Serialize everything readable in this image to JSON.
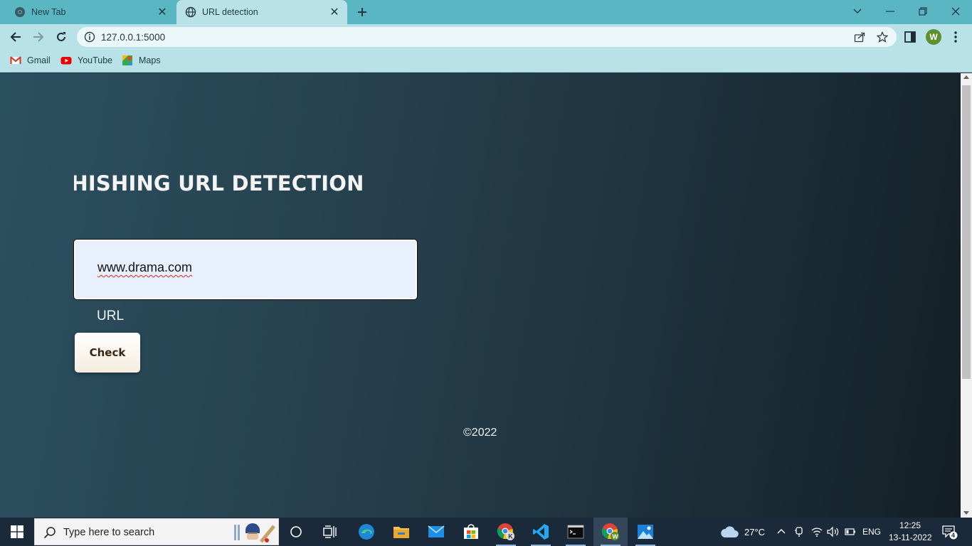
{
  "browser": {
    "tabs": [
      {
        "title": "New Tab",
        "active": false
      },
      {
        "title": "URL detection",
        "active": true
      }
    ],
    "address": "127.0.0.1:5000",
    "profile_initial": "W",
    "bookmarks": [
      {
        "label": "Gmail"
      },
      {
        "label": "YouTube"
      },
      {
        "label": "Maps"
      }
    ]
  },
  "page": {
    "title": "PHISHING URL DETECTION",
    "input_value": "www.drama.com",
    "input_label": "URL",
    "check_label": "Check",
    "footer": "©2022"
  },
  "taskbar": {
    "search_placeholder": "Type here to search",
    "weather": "27°C",
    "language": "ENG",
    "time": "12:25",
    "date": "13-11-2022",
    "notifications": "4"
  },
  "colors": {
    "tab_strip": "#5bb6c3",
    "toolbar": "#b9e2e8",
    "content_bg_start": "#2b5060",
    "content_bg_end": "#131f25",
    "input_bg": "#e8f0fe",
    "taskbar": "#1b2a3a"
  }
}
